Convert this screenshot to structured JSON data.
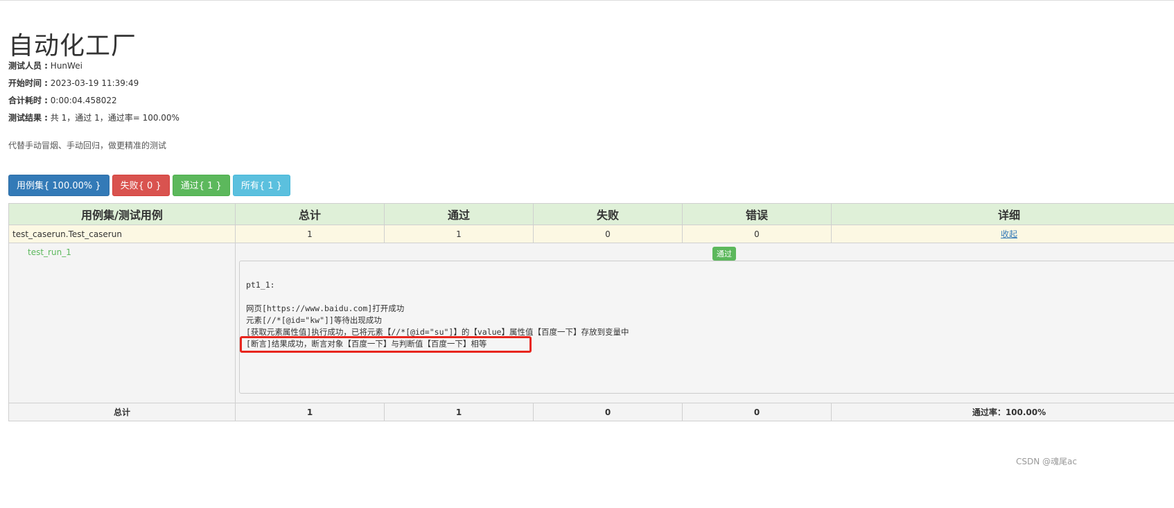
{
  "app_title": "自动化工厂",
  "info": {
    "tester_label": "测试人员 :",
    "tester_value": " HunWei",
    "start_label": "开始时间 :",
    "start_value": " 2023-03-19 11:39:49",
    "duration_label": "合计耗时 :",
    "duration_value": " 0:00:04.458022",
    "result_label": "测试结果 :",
    "result_value": " 共 1，通过 1，通过率= 100.00%"
  },
  "description": "代替手动冒烟、手动回归，做更精准的测试",
  "filters": {
    "suite": "用例集{ 100.00% }",
    "fail": "失败{ 0 }",
    "pass": "通过{ 1 }",
    "all": "所有{ 1 }"
  },
  "table": {
    "headers": [
      "用例集/测试用例",
      "总计",
      "通过",
      "失败",
      "错误",
      "详细"
    ],
    "suite_row": {
      "name": "test_caserun.Test_caserun",
      "total": "1",
      "pass": "1",
      "fail": "0",
      "error": "0",
      "detail_link": "收起"
    },
    "case": {
      "name": "test_run_1",
      "status_badge": "通过",
      "log_lines": [
        "pt1_1:",
        "网页[https://www.baidu.com]打开成功",
        "元素[//*[@id=\"kw\"]]等待出现成功",
        "[获取元素属性值]执行成功，已将元素【//*[@id=\"su\"]】的【value】属性值【百度一下】存放到变量中",
        "[断言]结果成功，断言对象【百度一下】与判断值【百度一下】相等"
      ]
    },
    "total_row": {
      "label": "总计",
      "total": "1",
      "pass": "1",
      "fail": "0",
      "error": "0",
      "pass_rate": "通过率：100.00%"
    }
  },
  "watermark": "CSDN @魂尾ac",
  "colors": {
    "header_bg": "#dff0d8",
    "suite_row_bg": "#fcf8e3",
    "pass_green": "#5cb85c",
    "highlight_red": "#e8261e"
  }
}
